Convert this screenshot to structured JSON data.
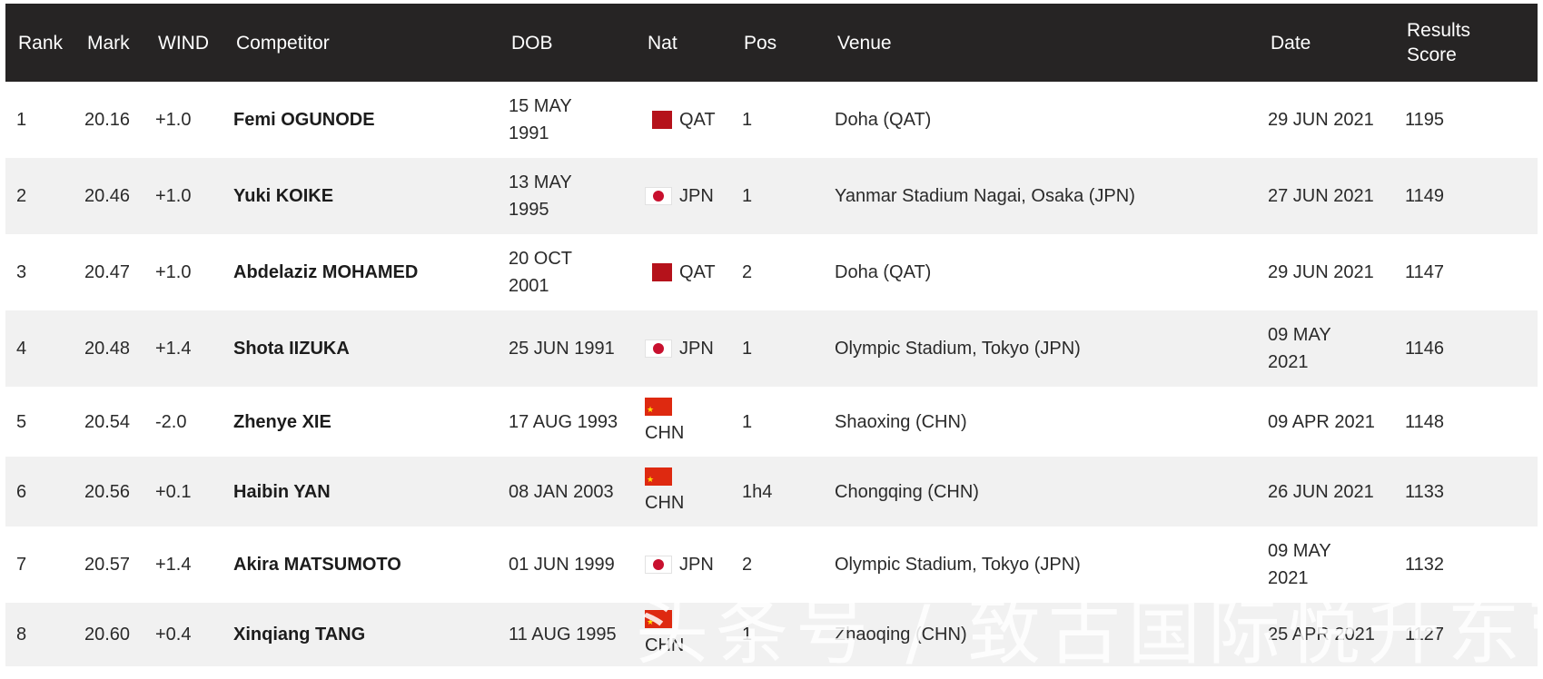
{
  "header": {
    "rank": "Rank",
    "mark": "Mark",
    "wind": "WIND",
    "competitor": "Competitor",
    "dob": "DOB",
    "nat": "Nat",
    "pos": "Pos",
    "venue": "Venue",
    "date": "Date",
    "results_score_line1": "Results",
    "results_score_line2": "Score"
  },
  "rows": [
    {
      "rank": "1",
      "mark": "20.16",
      "wind": "+1.0",
      "competitor": "Femi OGUNODE",
      "dob_line1": "15 MAY",
      "dob_line2": "1991",
      "flag": "qat-flag",
      "nat": "QAT",
      "pos": "1",
      "venue": "Doha (QAT)",
      "date_line1": "29 JUN 2021",
      "date_line2": "",
      "score": "1195"
    },
    {
      "rank": "2",
      "mark": "20.46",
      "wind": "+1.0",
      "competitor": "Yuki KOIKE",
      "dob_line1": "13 MAY",
      "dob_line2": "1995",
      "flag": "jpn-flag",
      "nat": "JPN",
      "pos": "1",
      "venue": "Yanmar Stadium Nagai, Osaka (JPN)",
      "date_line1": "27 JUN 2021",
      "date_line2": "",
      "score": "1149"
    },
    {
      "rank": "3",
      "mark": "20.47",
      "wind": "+1.0",
      "competitor": "Abdelaziz MOHAMED",
      "dob_line1": "20 OCT",
      "dob_line2": "2001",
      "flag": "qat-flag",
      "nat": "QAT",
      "pos": "2",
      "venue": "Doha (QAT)",
      "date_line1": "29 JUN 2021",
      "date_line2": "",
      "score": "1147"
    },
    {
      "rank": "4",
      "mark": "20.48",
      "wind": "+1.4",
      "competitor": "Shota IIZUKA",
      "dob_line1": "25 JUN 1991",
      "dob_line2": "",
      "flag": "jpn-flag",
      "nat": "JPN",
      "pos": "1",
      "venue": "Olympic Stadium, Tokyo (JPN)",
      "date_line1": "09 MAY",
      "date_line2": "2021",
      "score": "1146"
    },
    {
      "rank": "5",
      "mark": "20.54",
      "wind": "-2.0",
      "competitor": "Zhenye XIE",
      "dob_line1": "17 AUG 1993",
      "dob_line2": "",
      "flag": "chn-flag",
      "nat": "CHN",
      "pos": "1",
      "venue": "Shaoxing (CHN)",
      "date_line1": "09 APR 2021",
      "date_line2": "",
      "score": "1148"
    },
    {
      "rank": "6",
      "mark": "20.56",
      "wind": "+0.1",
      "competitor": "Haibin YAN",
      "dob_line1": "08 JAN 2003",
      "dob_line2": "",
      "flag": "chn-flag",
      "nat": "CHN",
      "pos": "1h4",
      "venue": "Chongqing (CHN)",
      "date_line1": "26 JUN 2021",
      "date_line2": "",
      "score": "1133"
    },
    {
      "rank": "7",
      "mark": "20.57",
      "wind": "+1.4",
      "competitor": "Akira MATSUMOTO",
      "dob_line1": "01 JUN 1999",
      "dob_line2": "",
      "flag": "jpn-flag",
      "nat": "JPN",
      "pos": "2",
      "venue": "Olympic Stadium, Tokyo (JPN)",
      "date_line1": "09 MAY",
      "date_line2": "2021",
      "score": "1132"
    },
    {
      "rank": "8",
      "mark": "20.60",
      "wind": "+0.4",
      "competitor": "Xinqiang TANG",
      "dob_line1": "11 AUG 1995",
      "dob_line2": "",
      "flag": "chn-flag",
      "nat": "CHN",
      "pos": "1",
      "venue": "Zhaoqing (CHN)",
      "date_line1": "25 APR 2021",
      "date_line2": "",
      "score": "1127"
    }
  ],
  "watermark": "头条号 / 致古国际悦升东营"
}
